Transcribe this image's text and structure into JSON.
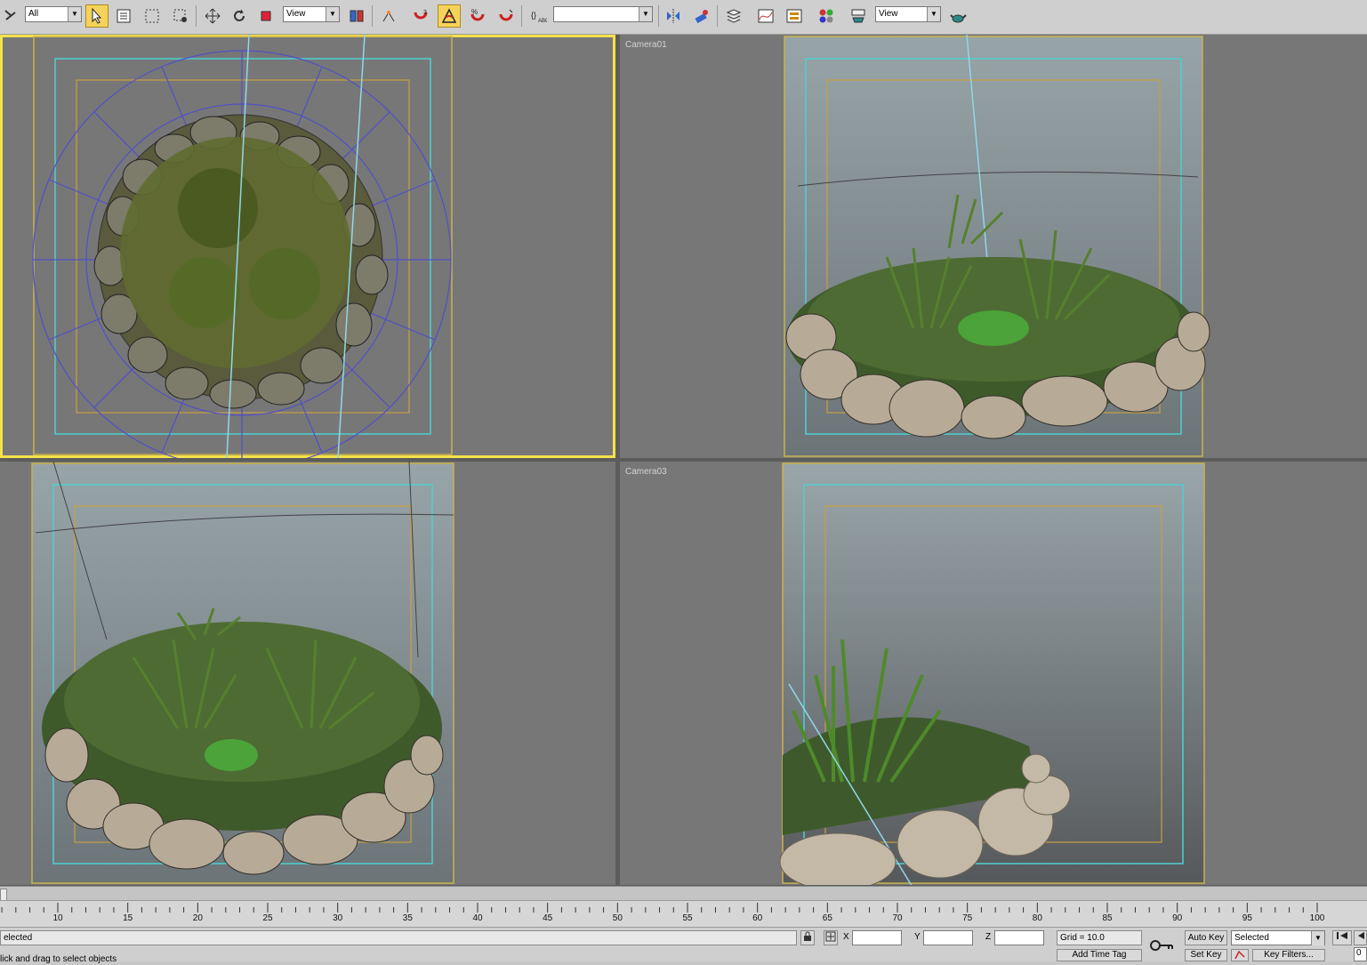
{
  "toolbar": {
    "selection_filter": "All",
    "ref_coord_system": "View",
    "named_selection": "",
    "render_preset": "View"
  },
  "viewports": {
    "top_left": {
      "label": ""
    },
    "top_right": {
      "label": "Camera01"
    },
    "bottom_left": {
      "label": ""
    },
    "bottom_right": {
      "label": "Camera03"
    }
  },
  "timeline": {
    "ticks": [
      "10",
      "15",
      "20",
      "25",
      "30",
      "35",
      "40",
      "45",
      "50",
      "55",
      "60",
      "65",
      "70",
      "75",
      "80",
      "85",
      "90",
      "95",
      "100"
    ]
  },
  "statusbar": {
    "selection_status": "elected",
    "prompt": "lick and drag to select objects",
    "x_label": "X",
    "y_label": "Y",
    "z_label": "Z",
    "grid": "Grid = 10.0",
    "add_time_tag": "Add Time Tag",
    "auto_key": "Auto Key",
    "set_key": "Set Key",
    "key_mode": "Selected",
    "key_filters": "Key Filters...",
    "frame": "0"
  },
  "colors": {
    "active_viewport": "#f4e24a",
    "safe_frame_outer": "#c9b34a",
    "safe_frame_cyan": "#4fd0d0",
    "safe_frame_inner": "#c9a040",
    "wire_blue": "#5050c8"
  }
}
